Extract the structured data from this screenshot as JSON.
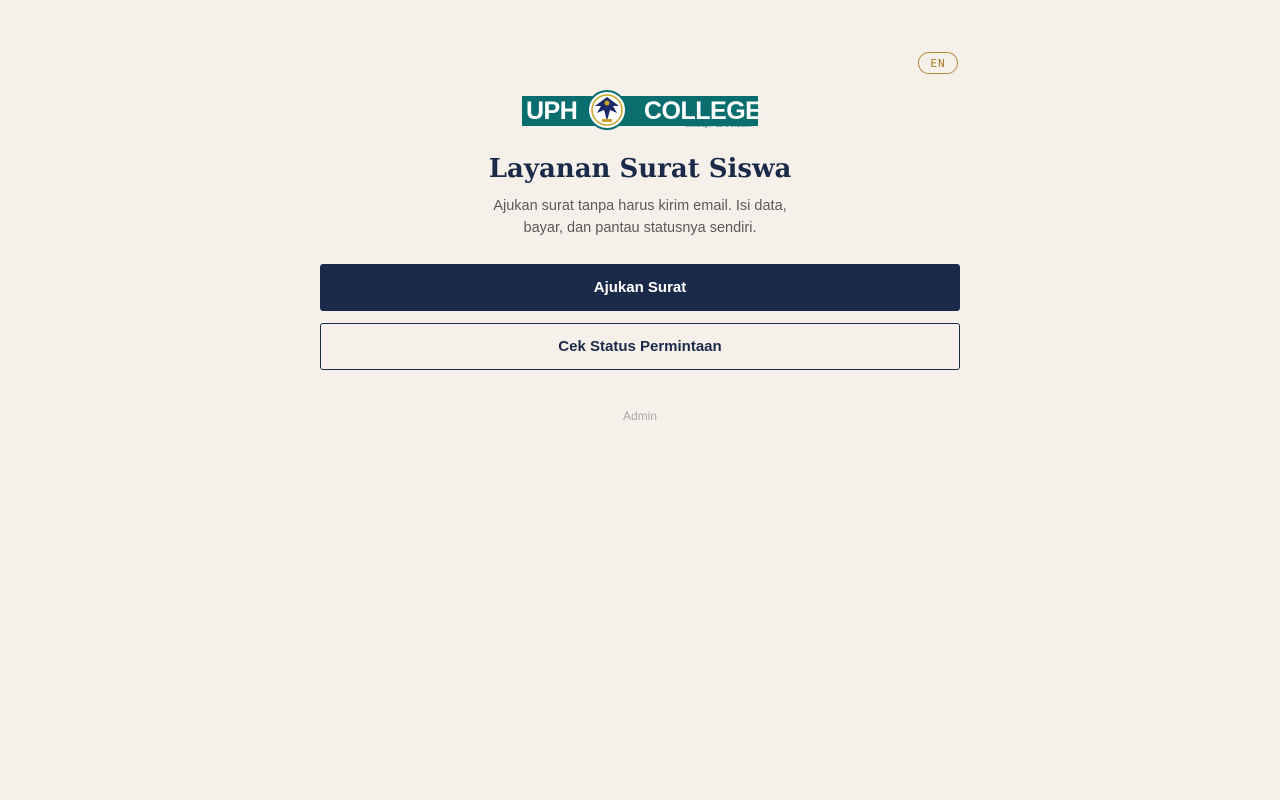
{
  "header": {
    "lang_toggle": "EN"
  },
  "logo": {
    "left_text": "UPH",
    "right_text": "COLLEGE",
    "tagline": "Knowledge, Faith & Character",
    "colors": {
      "bar": "#0a6e6e",
      "emblem_blue": "#1c2a6a",
      "emblem_gold": "#c9a227"
    }
  },
  "main": {
    "title": "Layanan Surat Siswa",
    "subtitle": "Ajukan surat tanpa harus kirim email. Isi data, bayar, dan pantau statusnya sendiri.",
    "primary_button": "Ajukan Surat",
    "secondary_button": "Cek Status Permintaan",
    "admin_link": "Admin"
  },
  "colors": {
    "background": "#f5f1ea",
    "navy": "#1c2a4a",
    "accent_gold": "#b58a3a",
    "muted_text": "#5a5a5a",
    "faint_text": "#a8a8a8"
  }
}
